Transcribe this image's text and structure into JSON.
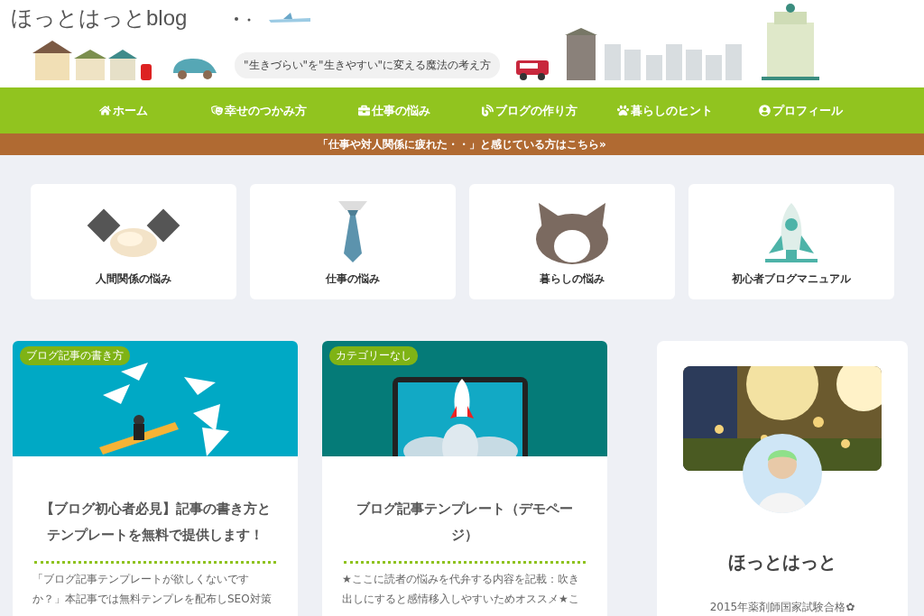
{
  "site_title": "ほっとはっとblog",
  "tagline": "\"生きづらい\"を\"生きやすい\"に変える魔法の考え方",
  "nav": [
    {
      "label": "ホーム"
    },
    {
      "label": "幸せのつかみ方"
    },
    {
      "label": "仕事の悩み"
    },
    {
      "label": "ブログの作り方"
    },
    {
      "label": "暮らしのヒント"
    },
    {
      "label": "プロフィール"
    }
  ],
  "banner": "「仕事や対人関係に疲れた・・」と感じている方はこちら»",
  "categories": [
    {
      "label": "人間関係の悩み"
    },
    {
      "label": "仕事の悩み"
    },
    {
      "label": "暮らしの悩み"
    },
    {
      "label": "初心者ブログマニュアル"
    }
  ],
  "posts": [
    {
      "category": "ブログ記事の書き方",
      "title": "【ブログ初心者必見】記事の書き方とテンプレートを無料で提供します！",
      "excerpt": "「ブログ記事テンプレートが欲しくないですか？」本記事では無料テンプレを配布しSEO対策"
    },
    {
      "category": "カテゴリーなし",
      "title": "ブログ記事テンプレート（デモページ）",
      "excerpt": "★ここに読者の悩みを代弁する内容を記載：吹き出しにすると感情移入しやすいためオススメ★こ"
    }
  ],
  "profile": {
    "name": "ほっとはっと",
    "bio": "2015年薬剤師国家試験合格✿"
  }
}
